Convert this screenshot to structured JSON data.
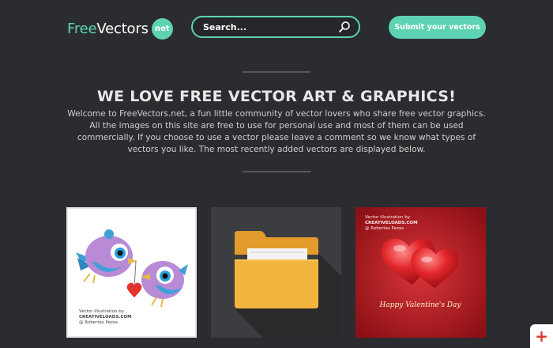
{
  "header": {
    "logo_free": "Free",
    "logo_vectors": "Vectors",
    "logo_badge": "net",
    "search_placeholder": "Search...",
    "submit_label": "Submit your vectors"
  },
  "hero": {
    "title": "WE LOVE FREE VECTOR ART & GRAPHICS!",
    "text": "Welcome to FreeVectors.net, a fun little community of vector lovers who share free vector graphics. All the images on this site are free to use for personal use and most of them can be used commercially. If you choose to use a vector please leave a comment so we know what types of vectors you like. The most recently added vectors are displayed below."
  },
  "cards": [
    {
      "credit_line1": "Vector illustration by",
      "credit_line2": "CREATIVELOADS.COM",
      "credit_line3": "@ Robertas Pezas"
    },
    {},
    {
      "credit_line1": "Vector illustration by",
      "credit_line2": "CREATIVELOADS.COM",
      "credit_line3": "@ Robertas Pezas",
      "caption": "Happy Valentine's Day"
    }
  ],
  "floating": {
    "plus_label": "+"
  },
  "colors": {
    "accent": "#5ed3b4",
    "background": "#2b2c30"
  }
}
